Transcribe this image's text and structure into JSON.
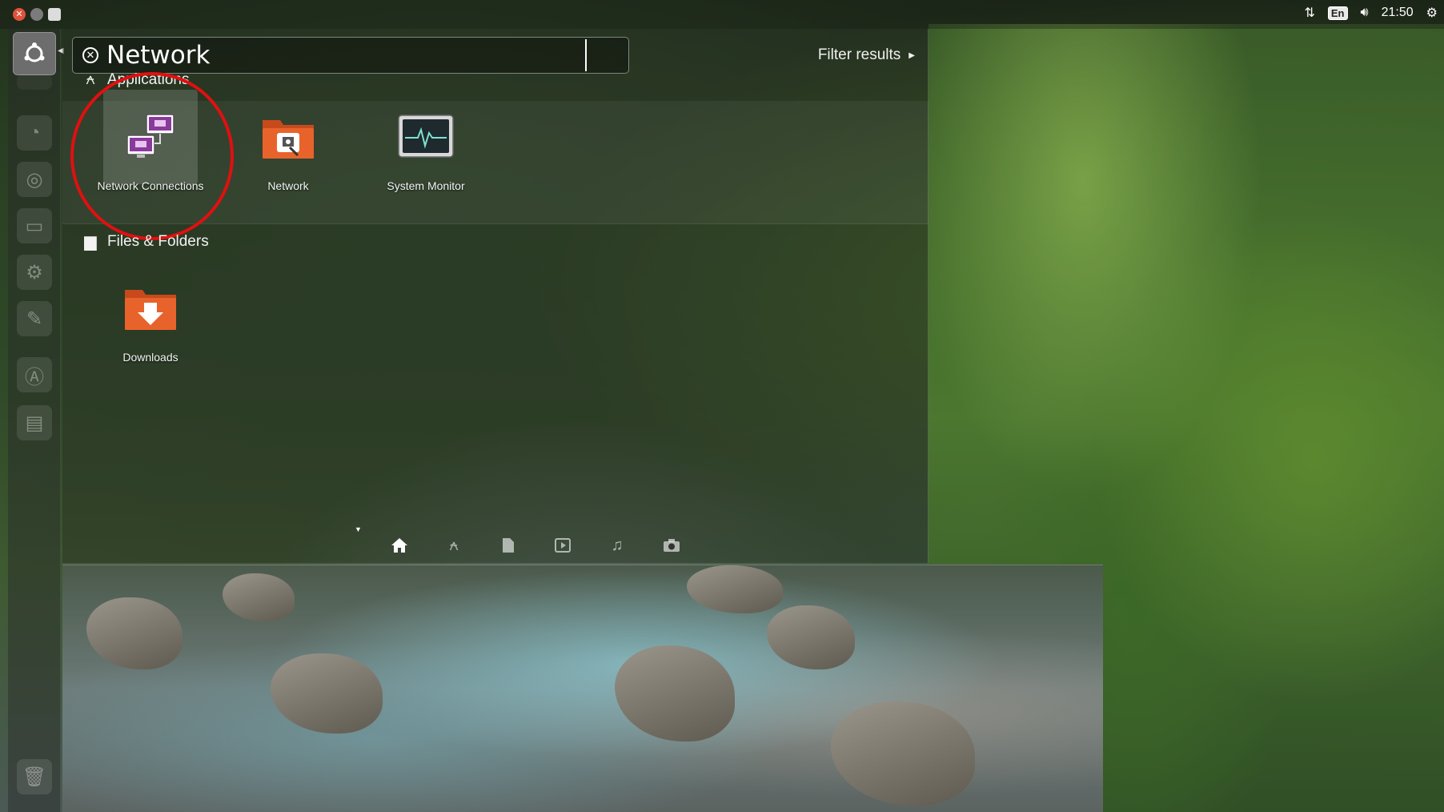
{
  "top_panel": {
    "indicators": {
      "network_icon": "network-arrows-icon",
      "keyboard_layout": "En",
      "volume_icon": "volume-icon",
      "clock": "21:50",
      "settings_icon": "gear-icon"
    }
  },
  "search": {
    "query": "Network"
  },
  "filter_results_label": "Filter results",
  "categories": {
    "applications": {
      "label": "Applications",
      "results": [
        {
          "label": "Network Connections",
          "icon": "network-connections-icon"
        },
        {
          "label": "Network",
          "icon": "network-folder-icon"
        },
        {
          "label": "System Monitor",
          "icon": "system-monitor-icon"
        }
      ]
    },
    "files_folders": {
      "label": "Files & Folders",
      "results": [
        {
          "label": "Downloads",
          "icon": "downloads-folder-icon"
        }
      ]
    }
  },
  "lenses": [
    {
      "name": "home",
      "icon": "home-icon",
      "active": true
    },
    {
      "name": "applications",
      "icon": "applications-icon",
      "active": false
    },
    {
      "name": "files",
      "icon": "file-icon",
      "active": false
    },
    {
      "name": "video",
      "icon": "video-icon",
      "active": false
    },
    {
      "name": "music",
      "icon": "music-icon",
      "active": false
    },
    {
      "name": "photos",
      "icon": "camera-icon",
      "active": false
    }
  ],
  "colors": {
    "highlight_circle": "#e01010",
    "folder_orange": "#e8632b",
    "network_purple": "#8a3a9c"
  }
}
